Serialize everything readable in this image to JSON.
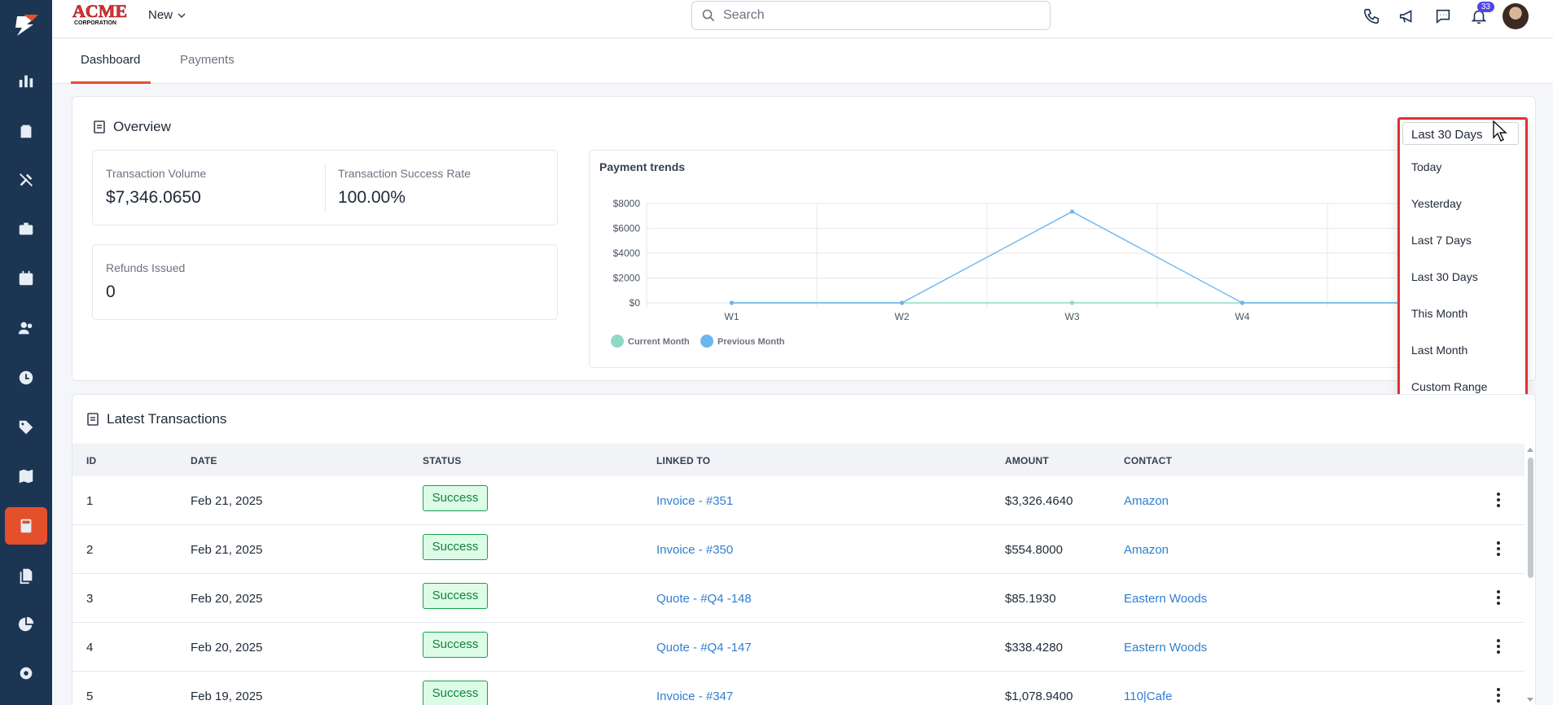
{
  "topbar": {
    "brand_top": "ACME",
    "brand_bottom": "CORPORATION",
    "new_label": "New",
    "search_placeholder": "Search",
    "notification_count": "33"
  },
  "tabs": [
    {
      "label": "Dashboard",
      "active": true
    },
    {
      "label": "Payments",
      "active": false
    }
  ],
  "overview": {
    "title": "Overview",
    "stats": {
      "volume_label": "Transaction Volume",
      "volume_value": "$7,346.0650",
      "success_label": "Transaction Success Rate",
      "success_value": "100.00%",
      "refunds_label": "Refunds Issued",
      "refunds_value": "0"
    },
    "range_selected": "Last 30 Days",
    "range_options": [
      "Today",
      "Yesterday",
      "Last 7 Days",
      "Last 30 Days",
      "This Month",
      "Last Month",
      "Custom Range"
    ]
  },
  "chart_data": {
    "type": "line",
    "title": "Payment trends",
    "categories": [
      "W1",
      "W2",
      "W3",
      "W4"
    ],
    "y_ticks": [
      "$0",
      "$2000",
      "$4000",
      "$6000",
      "$8000"
    ],
    "ylim": [
      0,
      8000
    ],
    "grid": true,
    "legend_position": "bottom-left",
    "series": [
      {
        "name": "Current Month",
        "values": [
          0,
          0,
          0,
          0
        ],
        "color": "#8fd8c4"
      },
      {
        "name": "Previous Month",
        "values": [
          0,
          0,
          7346,
          0
        ],
        "color": "#6cb6ee"
      }
    ]
  },
  "transactions": {
    "title": "Latest Transactions",
    "columns": [
      "ID",
      "DATE",
      "STATUS",
      "LINKED TO",
      "AMOUNT",
      "CONTACT"
    ],
    "rows": [
      {
        "id": "1",
        "date": "Feb 21, 2025",
        "status": "Success",
        "linked": "Invoice - #351",
        "amount": "$3,326.4640",
        "contact": "Amazon"
      },
      {
        "id": "2",
        "date": "Feb 21, 2025",
        "status": "Success",
        "linked": "Invoice - #350",
        "amount": "$554.8000",
        "contact": "Amazon"
      },
      {
        "id": "3",
        "date": "Feb 20, 2025",
        "status": "Success",
        "linked": "Quote - #Q4 -148",
        "amount": "$85.1930",
        "contact": "Eastern Woods"
      },
      {
        "id": "4",
        "date": "Feb 20, 2025",
        "status": "Success",
        "linked": "Quote - #Q4 -147",
        "amount": "$338.4280",
        "contact": "Eastern Woods"
      },
      {
        "id": "5",
        "date": "Feb 19, 2025",
        "status": "Success",
        "linked": "Invoice - #347",
        "amount": "$1,078.9400",
        "contact": "110|Cafe"
      }
    ]
  },
  "colors": {
    "sidebar": "#1c3553",
    "accent": "#e4502b",
    "link": "#2f7fd1",
    "success": "#16a34a",
    "highlight": "#e03131"
  }
}
